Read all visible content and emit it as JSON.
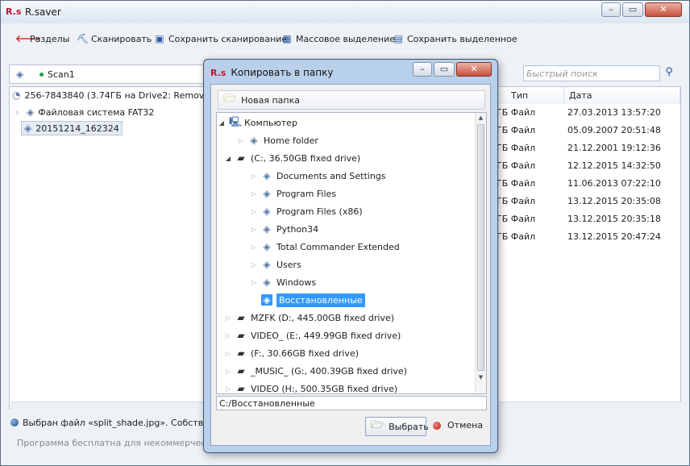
{
  "app": {
    "logo": "R.s",
    "title": "R.saver"
  },
  "toolbar": [
    {
      "label": "Разделы",
      "icon": "back-arrow-icon",
      "glyph": "🡐"
    },
    {
      "label": "Сканировать",
      "icon": "scan-icon",
      "glyph": "⛏"
    },
    {
      "label": "Сохранить сканирование",
      "icon": "save-icon",
      "glyph": "▣"
    },
    {
      "label": "Массовое выделение",
      "icon": "mass-select-icon",
      "glyph": "▦"
    },
    {
      "label": "Сохранить выделенное",
      "icon": "save-selected-icon",
      "glyph": "▤"
    }
  ],
  "address": {
    "text": "Scan1"
  },
  "search": {
    "placeholder": "Быстрый поиск"
  },
  "tree": {
    "root": "256-7843840 (3.74ГБ на Drive2: Removable ...",
    "items": [
      "Файловая система FAT32",
      "20151214_162324"
    ]
  },
  "list": {
    "columns": [
      "Тип",
      "Дата"
    ],
    "rows": [
      {
        "type": "ГБ Файл",
        "date": "27.03.2013 13:57:20"
      },
      {
        "type": "ГБ Файл",
        "date": "05.09.2007 20:51:48"
      },
      {
        "type": "ГБ Файл",
        "date": "21.12.2001 19:12:36"
      },
      {
        "type": "ГБ Файл",
        "date": "12.12.2015 14:32:50"
      },
      {
        "type": "ГБ Файл",
        "date": "11.06.2013 07:22:10"
      },
      {
        "type": "ГБ Файл",
        "date": "13.12.2015 20:35:08"
      },
      {
        "type": "ГБ Файл",
        "date": "13.12.2015 20:35:18"
      },
      {
        "type": "ГБ Файл",
        "date": "13.12.2015 20:47:24"
      }
    ]
  },
  "status": {
    "selected": "Выбран файл «split_shade.jpg». Собственн...",
    "info": "Программа бесплатна для некоммерческого и..."
  },
  "dialog": {
    "logo": "R.s",
    "title": "Копировать в папку",
    "new_folder": "Новая папка",
    "tree": [
      {
        "label": "Компьютер",
        "kind": "pc",
        "arrow": "open"
      },
      {
        "label": "Home folder",
        "kind": "folder",
        "arrow": "closed"
      },
      {
        "label": " (C:, 36.50GB fixed drive)",
        "kind": "drive",
        "arrow": "open"
      },
      {
        "label": "Documents and Settings",
        "kind": "folder",
        "arrow": "closed"
      },
      {
        "label": "Program Files",
        "kind": "folder",
        "arrow": "closed"
      },
      {
        "label": "Program Files (x86)",
        "kind": "folder",
        "arrow": "closed"
      },
      {
        "label": "Python34",
        "kind": "folder",
        "arrow": "closed"
      },
      {
        "label": "Total Commander Extended",
        "kind": "folder",
        "arrow": "closed"
      },
      {
        "label": "Users",
        "kind": "folder",
        "arrow": "closed"
      },
      {
        "label": "Windows",
        "kind": "folder",
        "arrow": "closed"
      },
      {
        "label": "Восстановленные",
        "kind": "folder",
        "arrow": "none",
        "selected": true
      },
      {
        "label": "MZFK (D:, 445.00GB fixed drive)",
        "kind": "drive",
        "arrow": "closed"
      },
      {
        "label": "VIDEO_ (E:, 449.99GB fixed drive)",
        "kind": "drive",
        "arrow": "closed"
      },
      {
        "label": " (F:, 30.66GB fixed drive)",
        "kind": "drive",
        "arrow": "closed"
      },
      {
        "label": "_MUSIC_ (G:, 400.39GB fixed drive)",
        "kind": "drive",
        "arrow": "closed"
      },
      {
        "label": "VIDEO (H:, 500.35GB fixed drive)",
        "kind": "drive",
        "arrow": "closed"
      }
    ],
    "path": "C:/Восстановленные",
    "ok_label": "Выбрать",
    "cancel_label": "Отмена"
  }
}
